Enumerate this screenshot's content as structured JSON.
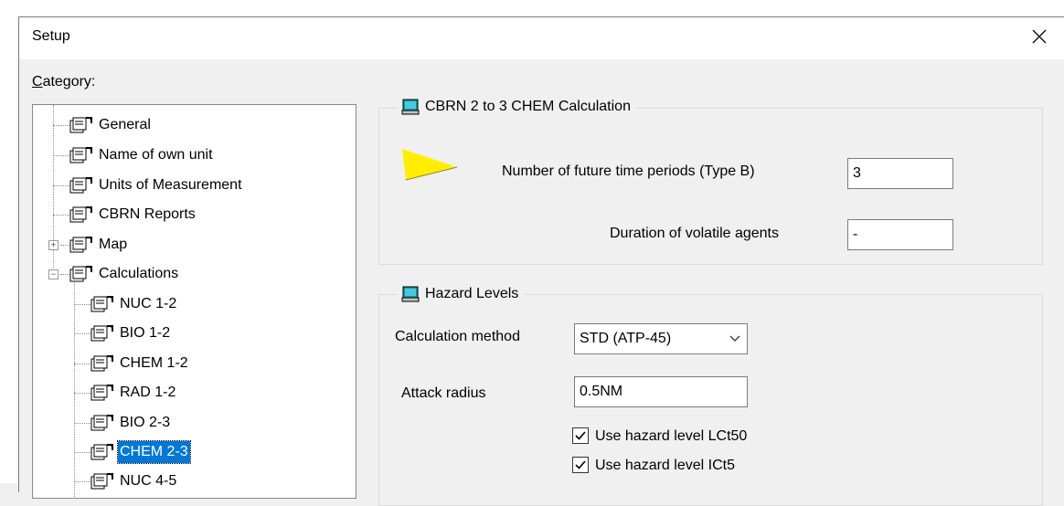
{
  "window": {
    "title": "Setup"
  },
  "category": {
    "label_prefix": "C",
    "label_rest": "ategory:",
    "items": [
      {
        "label": "General"
      },
      {
        "label": "Name of own unit"
      },
      {
        "label": "Units of Measurement"
      },
      {
        "label": "CBRN Reports"
      },
      {
        "label": "Map"
      },
      {
        "label": "Calculations"
      },
      {
        "label": "NUC 1-2"
      },
      {
        "label": "BIO 1-2"
      },
      {
        "label": "CHEM 1-2"
      },
      {
        "label": "RAD 1-2"
      },
      {
        "label": "BIO 2-3"
      },
      {
        "label": "CHEM 2-3"
      },
      {
        "label": "NUC 4-5"
      }
    ],
    "expand_symbol": "+",
    "collapse_symbol": "−"
  },
  "calc_group": {
    "title": "CBRN 2 to 3 CHEM Calculation",
    "future_periods_label": "Number of future time periods (Type B)",
    "future_periods_value": "3",
    "duration_label": "Duration of volatile agents",
    "duration_value": "-"
  },
  "hazard_group": {
    "title": "Hazard Levels",
    "method_label": "Calculation method",
    "method_value": "STD (ATP-45)",
    "radius_label": "Attack radius",
    "radius_value": "0.5NM",
    "lct50_label": "Use hazard level LCt50",
    "lct50_checked": true,
    "ict5_label": "Use hazard level ICt5",
    "ict5_checked": true
  },
  "colors": {
    "selection": "#0078d7",
    "pointer": "#ffee00"
  }
}
